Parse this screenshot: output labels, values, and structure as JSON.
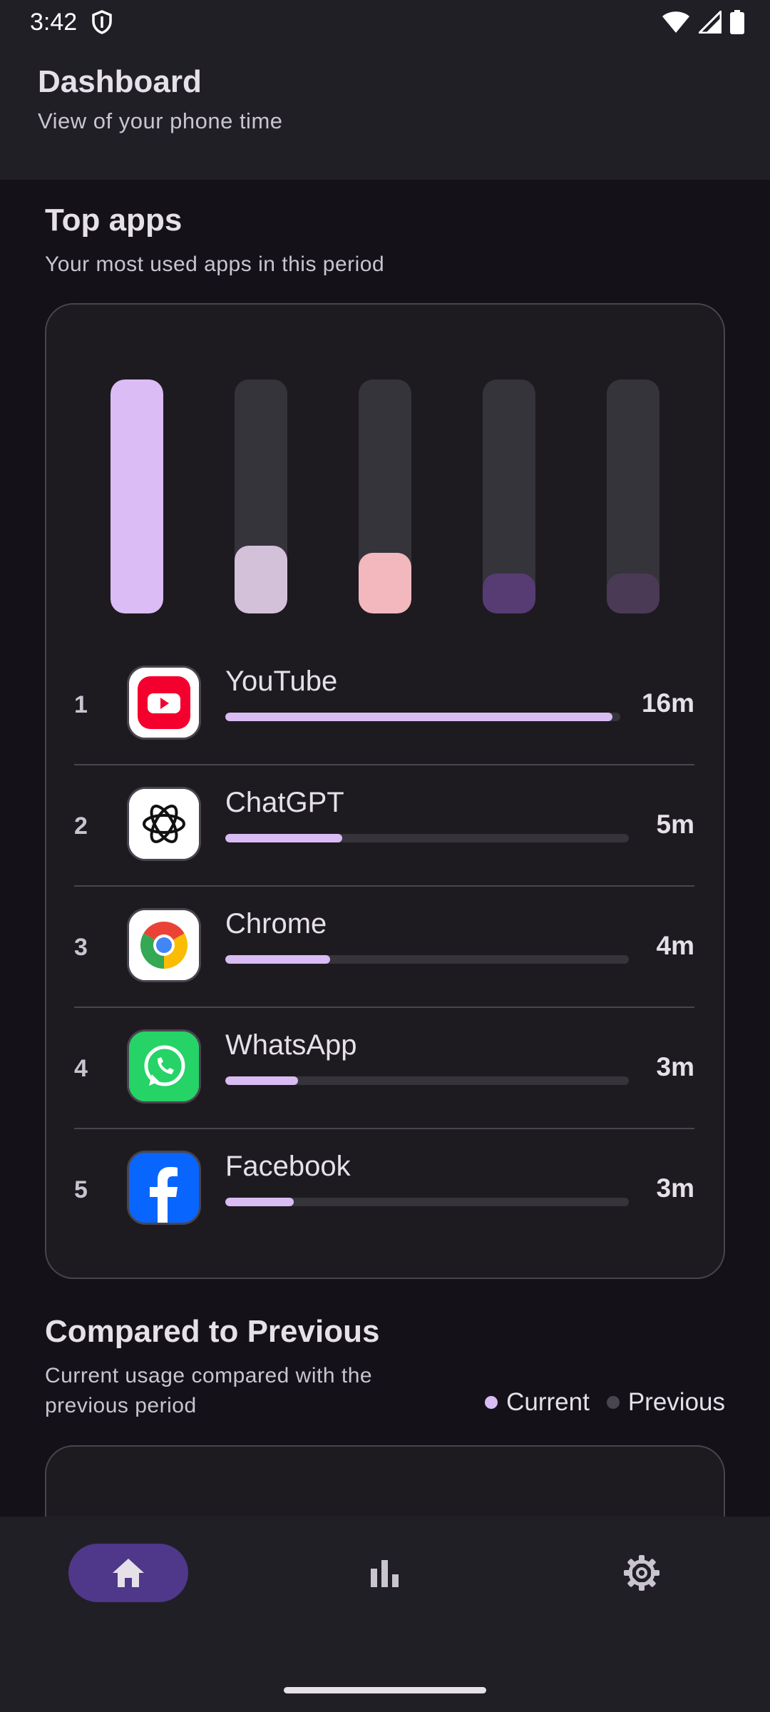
{
  "status": {
    "time": "3:42"
  },
  "header": {
    "title": "Dashboard",
    "subtitle": "View of your phone time"
  },
  "top_apps": {
    "title": "Top apps",
    "subtitle": "Your most used apps in this period",
    "chart_bars": [
      {
        "level": 1.0,
        "color": "#DCBCF4"
      },
      {
        "level": 0.29,
        "color": "#D3C1DA"
      },
      {
        "level": 0.26,
        "color": "#F2B8BE"
      },
      {
        "level": 0.17,
        "color": "#563C73"
      },
      {
        "level": 0.17,
        "color": "#4A3A55"
      }
    ],
    "apps": [
      {
        "rank": "1",
        "name": "YouTube",
        "time": "16m",
        "progress": 0.98,
        "icon": "youtube-icon"
      },
      {
        "rank": "2",
        "name": "ChatGPT",
        "time": "5m",
        "progress": 0.29,
        "icon": "chatgpt-icon"
      },
      {
        "rank": "3",
        "name": "Chrome",
        "time": "4m",
        "progress": 0.26,
        "icon": "chrome-icon"
      },
      {
        "rank": "4",
        "name": "WhatsApp",
        "time": "3m",
        "progress": 0.18,
        "icon": "whatsapp-icon"
      },
      {
        "rank": "5",
        "name": "Facebook",
        "time": "3m",
        "progress": 0.17,
        "icon": "facebook-icon"
      }
    ]
  },
  "compare": {
    "title": "Compared to Previous",
    "subtitle": "Current usage compared with the previous period",
    "legend_current": "Current",
    "legend_previous": "Previous",
    "current_color": "#D9BCF3",
    "previous_color": "#49454F"
  },
  "nav": {
    "items": [
      {
        "icon": "home-icon",
        "selected": true
      },
      {
        "icon": "bar-chart-icon",
        "selected": false
      },
      {
        "icon": "settings-icon",
        "selected": false
      }
    ]
  }
}
